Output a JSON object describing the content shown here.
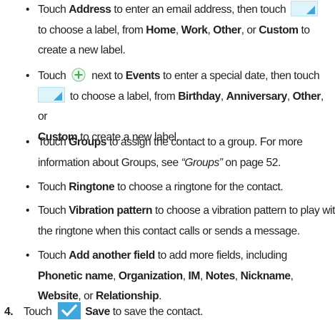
{
  "bullet": "•",
  "items": [
    {
      "t1": "Touch ",
      "b1": "Address",
      "t2": " to enter an email address, then touch ",
      "t3": " to choose a label, from ",
      "b2": "Home",
      "c1": ", ",
      "b3": "Work",
      "c2": ", ",
      "b4": "Other",
      "c3": ", or ",
      "b5": "Custom",
      "t4": " to create a new label."
    },
    {
      "t1": "Touch ",
      "t2": " next to ",
      "b1": "Events",
      "t3": " to enter a special date, then touch ",
      "t4": " to choose a label, from ",
      "b2": "Birthday",
      "c1": ", ",
      "b3": "Anniversary",
      "c2": ", ",
      "b4": "Other",
      "c3": ", or ",
      "b5": "Custom",
      "t5": " to create a new label."
    },
    {
      "t1": "Touch ",
      "b1": "Groups",
      "t2": " to assign the contact to a group. For more information about Groups, see ",
      "i1": "“Groups”",
      "t3": " on page 52."
    },
    {
      "t1": "Touch ",
      "b1": "Ringtone",
      "t2": " to choose a ringtone for the contact."
    },
    {
      "t1": "Touch ",
      "b1": "Vibration pattern",
      "t2": " to choose a vibration pattern to play with the ringtone when this contact calls or sends a message."
    },
    {
      "t1": "Touch ",
      "b1": "Add another field",
      "t2": " to add more fields, including ",
      "b2": "Phonetic name",
      "c1": ", ",
      "b3": "Organization",
      "c2": ", ",
      "b4": "IM",
      "c3": ", ",
      "b5": "Notes",
      "c4": ", ",
      "b6": "Nickname",
      "c5": ", ",
      "b7": "Website",
      "c6": ", or ",
      "b8": "Relationship",
      "t3": "."
    }
  ],
  "step4": {
    "number": "4.",
    "t1": "Touch ",
    "b1": "Save",
    "t2": " to save the contact."
  },
  "colors": {
    "icon_blue": "#3ea7dd",
    "dropdown_bg": "#dff3fb",
    "plus_green": "#3cae49"
  },
  "icons": {
    "dropdown": "dropdown-label-icon",
    "plus": "plus-icon",
    "save": "checkmark-save-icon"
  }
}
